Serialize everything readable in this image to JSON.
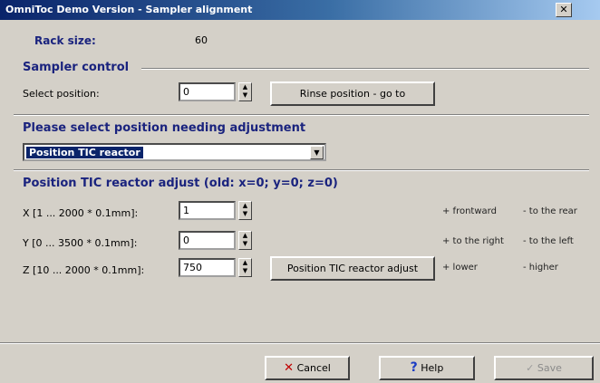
{
  "window": {
    "title": "OmniToc Demo Version - Sampler alignment"
  },
  "rack": {
    "label": "Rack size:",
    "value": "60"
  },
  "sampler_control": {
    "title": "Sampler control",
    "select_label": "Select position:",
    "position_value": "0",
    "goto_button": "Rinse position - go to"
  },
  "select_section": {
    "title": "Please select position needing adjustment",
    "selected": "Position TIC reactor"
  },
  "adjust": {
    "title": "Position TIC reactor adjust (old: x=0; y=0; z=0)",
    "x": {
      "label": "X [1 ... 2000 * 0.1mm]:",
      "value": "1",
      "plus": "+ frontward",
      "minus": "- to the rear"
    },
    "y": {
      "label": "Y [0 ... 3500 * 0.1mm]:",
      "value": "0",
      "plus": "+ to the right",
      "minus": "- to the left"
    },
    "z": {
      "label": "Z [10 ... 2000 * 0.1mm]:",
      "value": "750",
      "plus": "+ lower",
      "minus": "- higher"
    },
    "apply_button": "Position TIC reactor adjust"
  },
  "footer": {
    "cancel": "Cancel",
    "help": "Help",
    "save": "Save"
  },
  "colors": {
    "title_start": "#0a246a",
    "title_end": "#a6caf0",
    "dialog": "#d4d0c8",
    "heading": "#1a237e"
  },
  "icons": {
    "close": "close-icon",
    "cancel": "x-icon",
    "help": "question-icon",
    "save": "check-icon"
  }
}
